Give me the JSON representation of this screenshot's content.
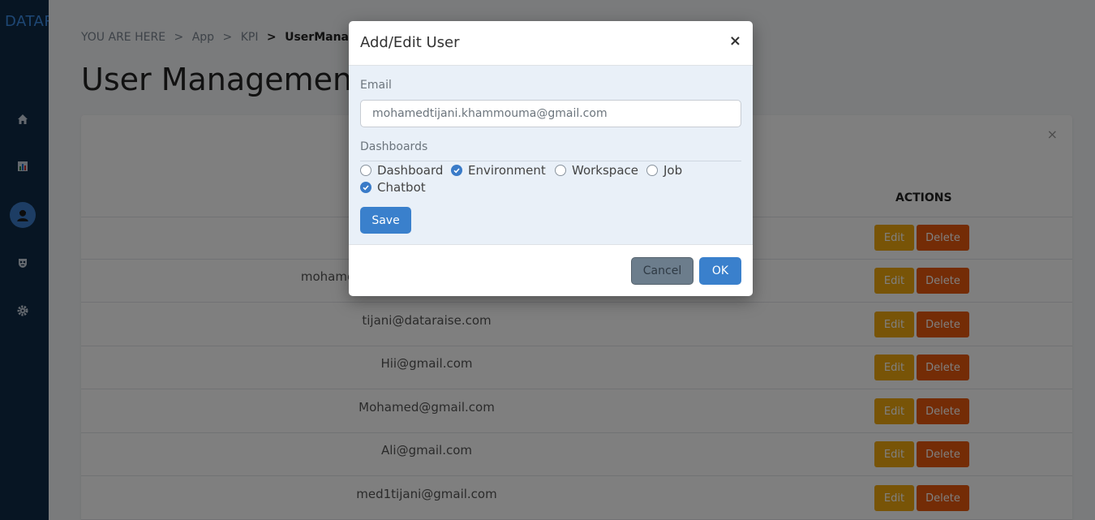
{
  "app": {
    "brand": "DATARAISE"
  },
  "sidebar": {
    "items": [
      {
        "name": "home",
        "icon": "home-icon"
      },
      {
        "name": "kpi",
        "icon": "bar-chart-icon"
      },
      {
        "name": "users",
        "icon": "user-icon",
        "active": true
      },
      {
        "name": "security",
        "icon": "mask-icon"
      },
      {
        "name": "settings",
        "icon": "gear-icon"
      }
    ]
  },
  "breadcrumb": {
    "prefix": "YOU ARE HERE",
    "sep": ">",
    "items": [
      "App",
      "KPI"
    ],
    "current": "UserManagement"
  },
  "page": {
    "title": "User Management"
  },
  "card": {
    "close": "×"
  },
  "table": {
    "actions_header": "ACTIONS",
    "edit_label": "Edit",
    "delete_label": "Delete",
    "rows": [
      {
        "email": ""
      },
      {
        "email": "mohamedtijani.khammouma@gmail.com"
      },
      {
        "email": "tijani@dataraise.com"
      },
      {
        "email": "Hii@gmail.com"
      },
      {
        "email": "Mohamed@gmail.com"
      },
      {
        "email": "Ali@gmail.com"
      },
      {
        "email": "med1tijani@gmail.com"
      }
    ]
  },
  "modal": {
    "title": "Add/Edit User",
    "close": "×",
    "email_label": "Email",
    "email_value": "mohamedtijani.khammouma@gmail.com",
    "dashboards_label": "Dashboards",
    "options": [
      {
        "label": "Dashboard",
        "checked": false
      },
      {
        "label": "Environment",
        "checked": true
      },
      {
        "label": "Workspace",
        "checked": false
      },
      {
        "label": "Job",
        "checked": false
      },
      {
        "label": "Chatbot",
        "checked": true
      }
    ],
    "save_label": "Save",
    "cancel_label": "Cancel",
    "ok_label": "OK"
  },
  "colors": {
    "sidebar": "#0e2a47",
    "primary": "#3a80cc",
    "edit": "#f0a80e",
    "delete": "#e8590c"
  }
}
